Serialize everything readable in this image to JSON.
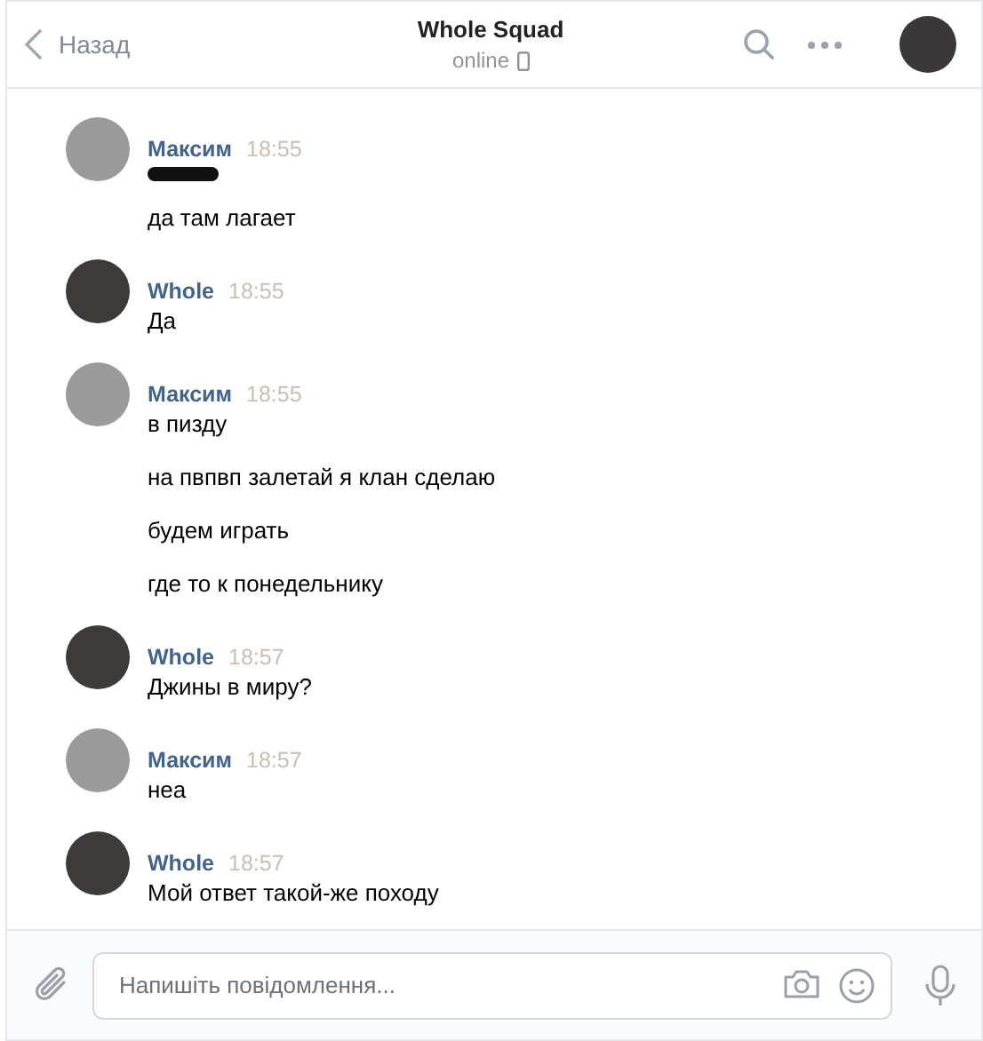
{
  "header": {
    "back_label": "Назад",
    "title": "Whole Squad",
    "status": "online"
  },
  "groups": [
    {
      "author": "Максим",
      "time": "18:55",
      "kind": "light",
      "messages": [
        {
          "kind": "redacted"
        },
        {
          "kind": "text",
          "text": "да там лагает"
        }
      ]
    },
    {
      "author": "Whole",
      "time": "18:55",
      "kind": "dark",
      "messages": [
        {
          "kind": "text",
          "text": "Да"
        }
      ]
    },
    {
      "author": "Максим",
      "time": "18:55",
      "kind": "light",
      "messages": [
        {
          "kind": "text",
          "text": "в пизду"
        },
        {
          "kind": "text",
          "text": "на пвпвп залетай я клан сделаю"
        },
        {
          "kind": "text",
          "text": "будем играть"
        },
        {
          "kind": "text",
          "text": "где то к понедельнику"
        }
      ]
    },
    {
      "author": "Whole",
      "time": "18:57",
      "kind": "dark",
      "messages": [
        {
          "kind": "text",
          "text": "Джины в миру?"
        }
      ]
    },
    {
      "author": "Максим",
      "time": "18:57",
      "kind": "light",
      "messages": [
        {
          "kind": "text",
          "text": "неа"
        }
      ]
    },
    {
      "author": "Whole",
      "time": "18:57",
      "kind": "dark",
      "messages": [
        {
          "kind": "text",
          "text": "Мой ответ такой-же походу"
        }
      ]
    }
  ],
  "composer": {
    "placeholder": "Напишіть повідомлення..."
  }
}
